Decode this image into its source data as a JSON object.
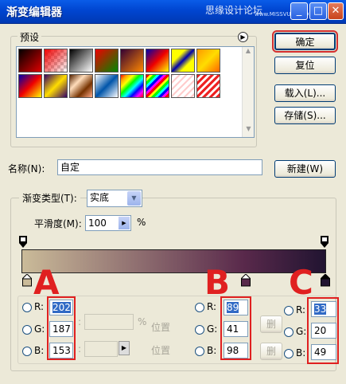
{
  "window": {
    "title": "渐变编辑器",
    "watermark": "思缘设计论坛",
    "watermark_url": "www.MISSVUAN.COM"
  },
  "buttons": {
    "ok": "确定",
    "reset": "复位",
    "load": "载入(L)...",
    "save": "存储(S)...",
    "new": "新建(W)"
  },
  "presets": {
    "label": "预设"
  },
  "name": {
    "label": "名称(N):",
    "value": "自定"
  },
  "gradient_type": {
    "label": "渐变类型(T):",
    "value": "实底"
  },
  "smoothness": {
    "label": "平滑度(M):",
    "value": "100",
    "unit": "%"
  },
  "gradient": {
    "colors": [
      "#cabb99",
      "#59294b",
      "#211431"
    ]
  },
  "stop_a": {
    "letter": "A",
    "r": "202",
    "g": "187",
    "b": "153",
    "percent": "%",
    "position": "位置",
    "delete": "删"
  },
  "stop_b": {
    "letter": "B",
    "r": "89",
    "g": "41",
    "b": "98",
    "position_label": "位置",
    "position_label2": "位置",
    "delete": "删"
  },
  "stop_c": {
    "letter": "C",
    "r": "33",
    "g": "20",
    "b": "49"
  },
  "channels": {
    "r": "R:",
    "g": "G:",
    "b": "B:"
  }
}
